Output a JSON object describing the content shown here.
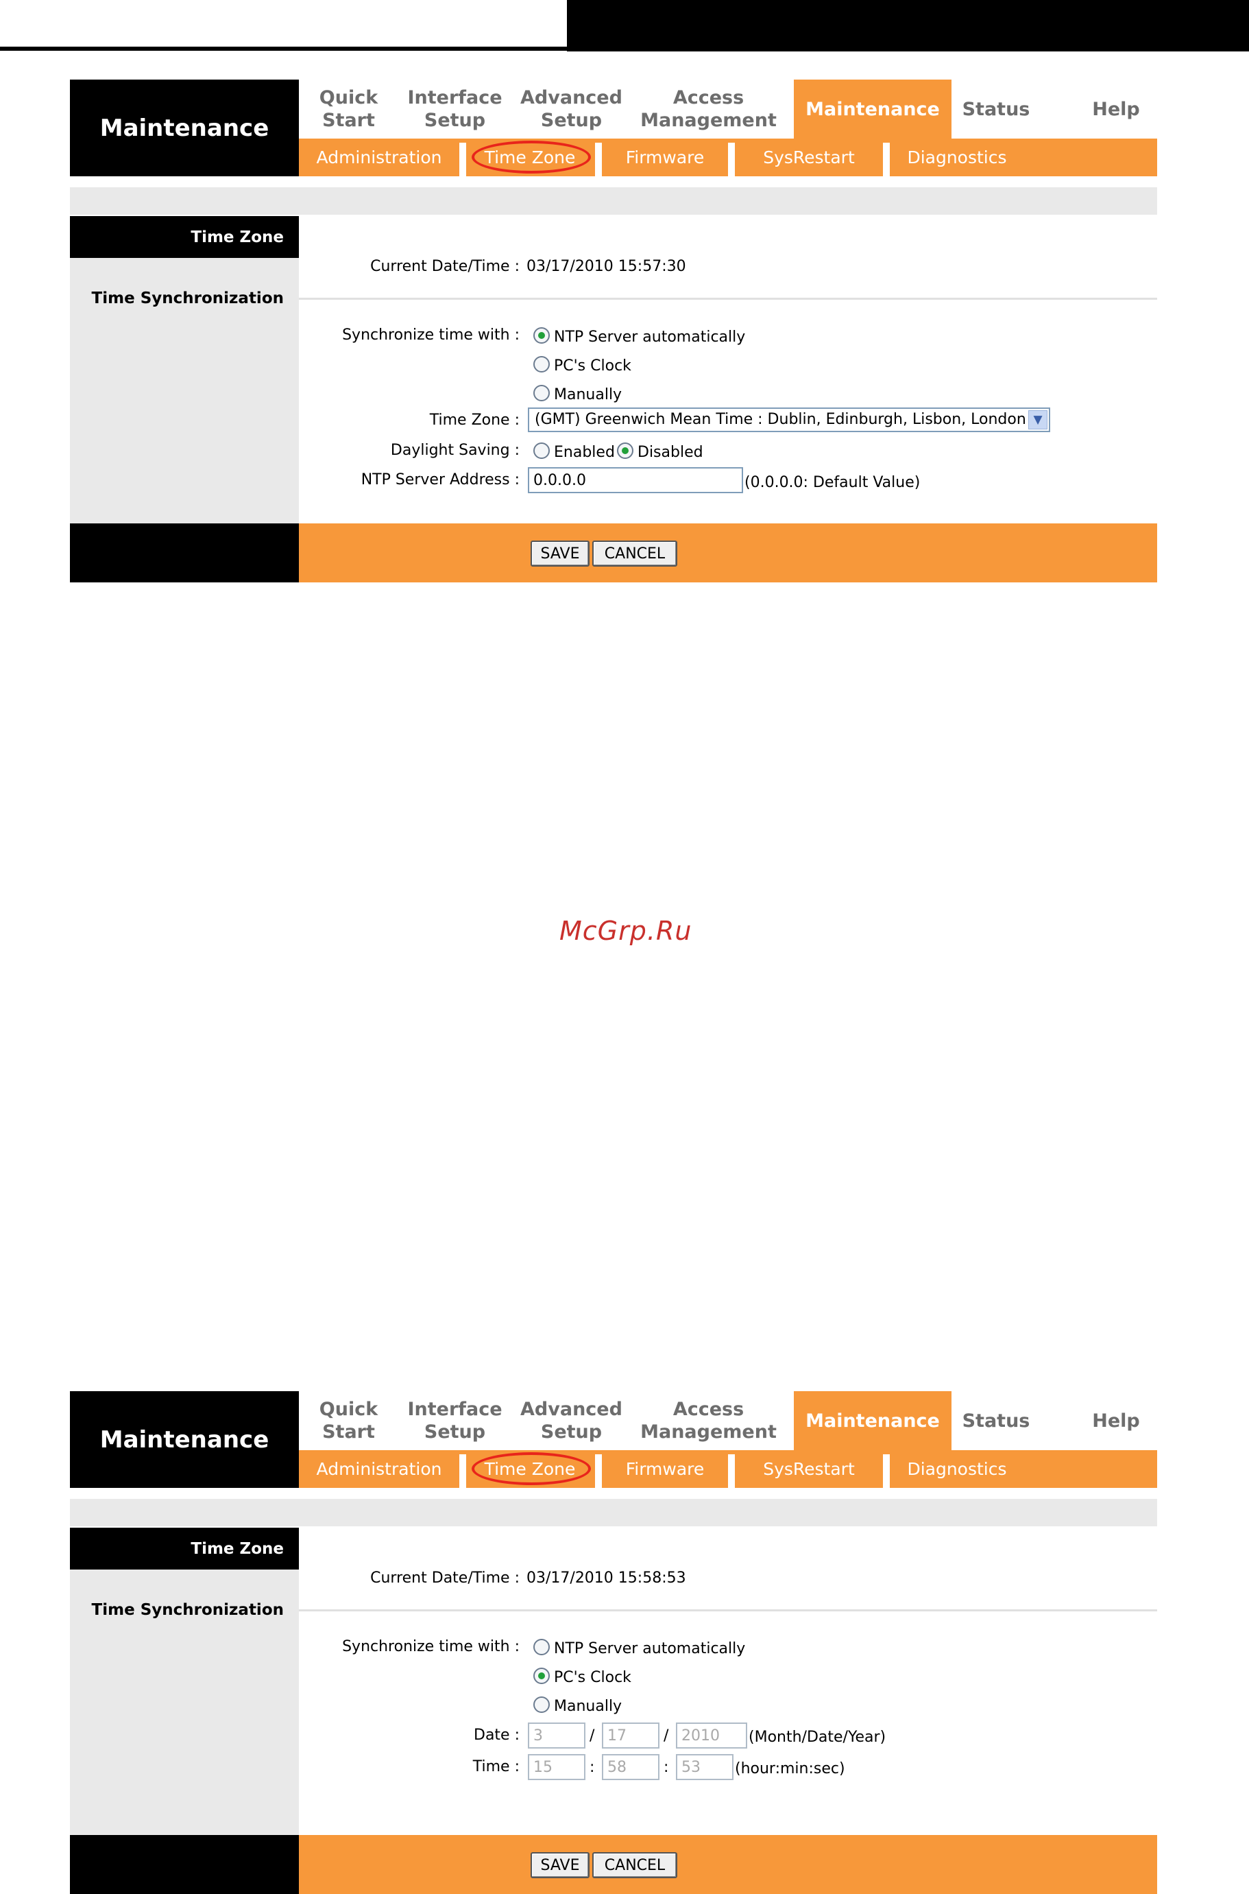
{
  "nav": {
    "brand": "Maintenance",
    "tabs": [
      {
        "line1": "Quick",
        "line2": "Start"
      },
      {
        "line1": "Interface",
        "line2": "Setup"
      },
      {
        "line1": "Advanced",
        "line2": "Setup"
      },
      {
        "line1": "Access",
        "line2": "Management"
      },
      {
        "line1": "Maintenance",
        "line2": ""
      },
      {
        "line1": "Status",
        "line2": ""
      },
      {
        "line1": "Help",
        "line2": ""
      }
    ],
    "subtabs": [
      "Administration",
      "Time Zone",
      "Firmware",
      "SysRestart",
      "Diagnostics"
    ]
  },
  "common": {
    "section_title": "Time Zone",
    "section_label": "Time Synchronization",
    "current_label": "Current Date/Time :",
    "sync_label": "Synchronize time with :",
    "opt_ntp": "NTP Server automatically",
    "opt_pc": "PC's Clock",
    "opt_manual": "Manually",
    "save": "SAVE",
    "cancel": "CANCEL"
  },
  "panel1": {
    "current_value": "03/17/2010 15:57:30",
    "selected_sync": "NTP Server automatically",
    "timezone_label": "Time Zone :",
    "timezone_value": "(GMT) Greenwich Mean Time : Dublin, Edinburgh, Lisbon, London",
    "daylight_label": "Daylight Saving :",
    "daylight_enabled": "Enabled",
    "daylight_disabled": "Disabled",
    "daylight_selected": "Disabled",
    "ntp_label": "NTP Server Address :",
    "ntp_value": "0.0.0.0",
    "ntp_hint": "(0.0.0.0: Default Value)"
  },
  "panel2": {
    "current_value": "03/17/2010 15:58:53",
    "selected_sync": "PC's Clock",
    "date_label": "Date :",
    "date_month": "3",
    "date_day": "17",
    "date_year": "2010",
    "date_sep": "/",
    "date_hint": "(Month/Date/Year)",
    "time_label": "Time :",
    "time_hour": "15",
    "time_min": "58",
    "time_sec": "53",
    "time_sep": ":",
    "time_hint": "(hour:min:sec)"
  },
  "watermark": "McGrp.Ru",
  "colors": {
    "accent": "#f7983a",
    "panel_gray": "#e9e9e9",
    "highlight": "#e8251b"
  }
}
